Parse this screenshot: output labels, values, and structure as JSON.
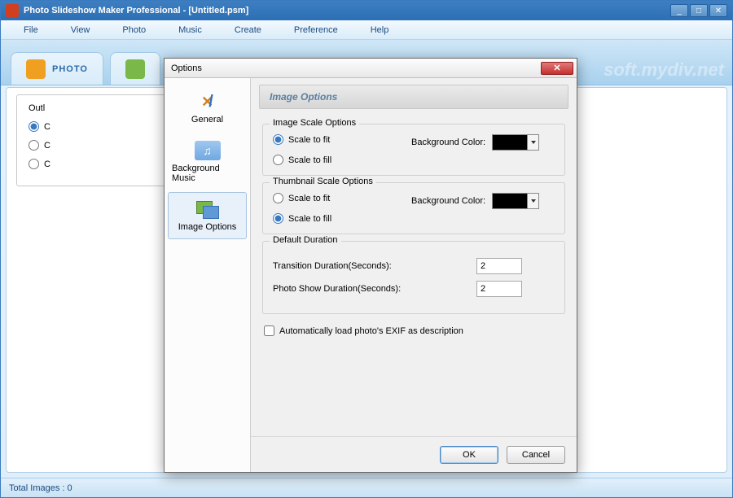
{
  "app": {
    "title": "Photo Slideshow Maker Professional - [Untitled.psm]"
  },
  "menu": {
    "file": "File",
    "view": "View",
    "photo": "Photo",
    "music": "Music",
    "create": "Create",
    "preference": "Preference",
    "help": "Help"
  },
  "tabs": {
    "photo": "PHOTO"
  },
  "watermark": "soft.mydiv.net",
  "background_group": {
    "title": "Outl",
    "opt_c1": "C",
    "opt_c2": "C",
    "opt_c3": "C"
  },
  "statusbar": {
    "text": "Total Images : 0"
  },
  "dialog": {
    "title": "Options",
    "sidebar": {
      "general": "General",
      "bgmusic": "Background Music",
      "imgopt": "Image Options"
    },
    "header": "Image Options",
    "image_scale": {
      "title": "Image Scale Options",
      "fit": "Scale to fit",
      "fill": "Scale to fill",
      "bgcolor_label": "Background Color:",
      "bgcolor": "#000000",
      "selected": "fit"
    },
    "thumb_scale": {
      "title": "Thumbnail Scale Options",
      "fit": "Scale to fit",
      "fill": "Scale to fill",
      "bgcolor_label": "Background Color:",
      "bgcolor": "#000000",
      "selected": "fill"
    },
    "duration": {
      "title": "Default Duration",
      "transition_label": "Transition Duration(Seconds):",
      "transition_value": "2",
      "photo_label": "Photo Show Duration(Seconds):",
      "photo_value": "2"
    },
    "exif_checkbox": "Automatically load photo's EXIF as description",
    "buttons": {
      "ok": "OK",
      "cancel": "Cancel"
    }
  }
}
